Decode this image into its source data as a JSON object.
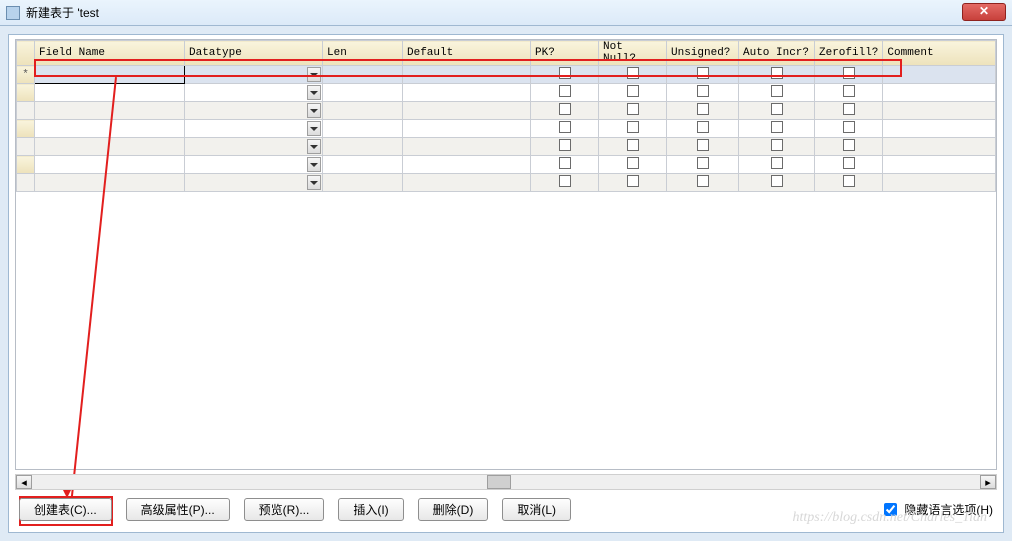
{
  "window": {
    "title": "新建表于 'test"
  },
  "columns": [
    "Field Name",
    "Datatype",
    "Len",
    "Default",
    "PK?",
    "Not Null?",
    "Unsigned?",
    "Auto Incr?",
    "Zerofill?",
    "Comment"
  ],
  "rows": [
    {
      "marker": "*",
      "selected": true
    },
    {
      "marker": "",
      "selected": false
    },
    {
      "marker": "",
      "selected": false,
      "alt": true
    },
    {
      "marker": "",
      "selected": false
    },
    {
      "marker": "",
      "selected": false,
      "alt": true
    },
    {
      "marker": "",
      "selected": false
    },
    {
      "marker": "",
      "selected": false,
      "alt": true
    }
  ],
  "buttons": {
    "create": "创建表(C)...",
    "advanced": "高级属性(P)...",
    "preview": "预览(R)...",
    "insert": "插入(I)",
    "delete": "删除(D)",
    "cancel": "取消(L)"
  },
  "hide_lang_option": {
    "label": "隐藏语言选项(H)",
    "checked": true
  },
  "watermark": "https://blog.csdn.net/Charles_Tian"
}
